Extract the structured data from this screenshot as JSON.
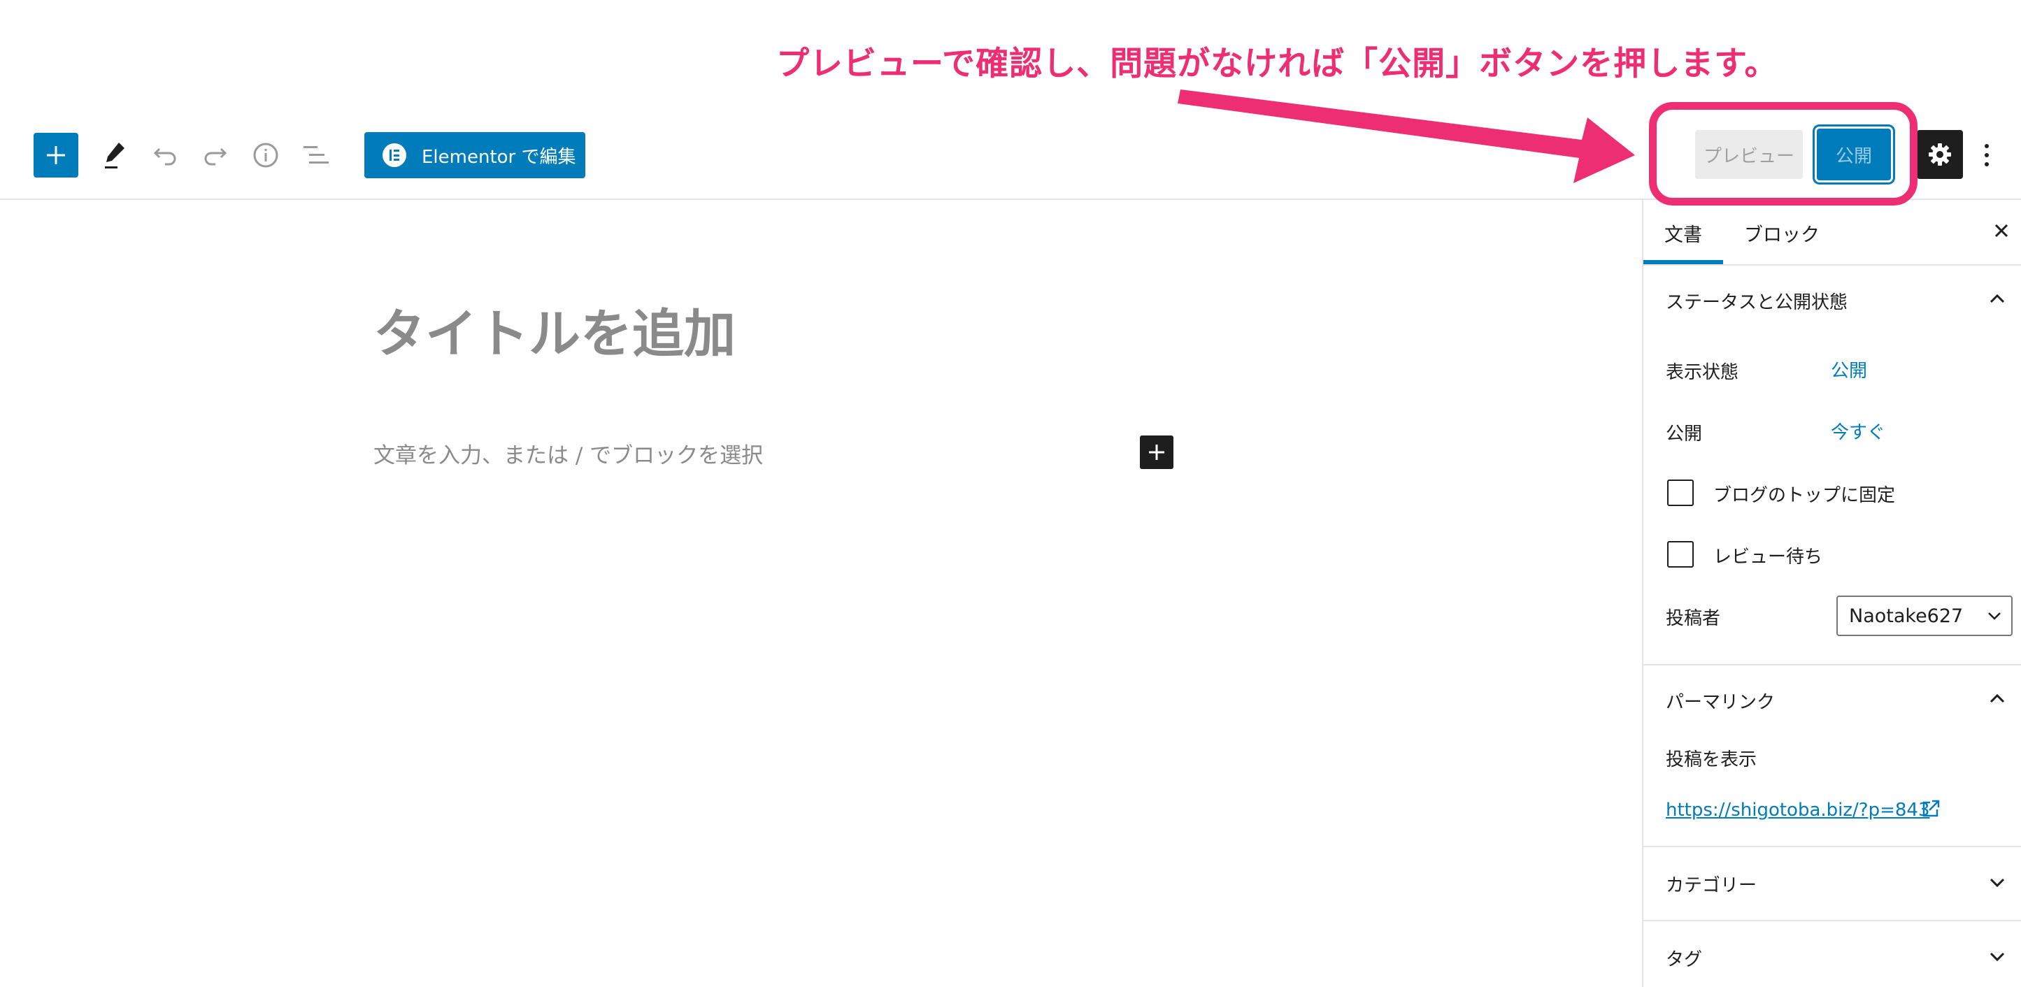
{
  "annotation": {
    "text": "プレビューで確認し、問題がなければ「公開」ボタンを押します。",
    "color": "#ee2e73"
  },
  "toolbar": {
    "elementor_label": "Elementor で編集",
    "preview_label": "プレビュー",
    "publish_label": "公開",
    "icons": [
      "plus-icon",
      "pencil-icon",
      "undo-icon",
      "redo-icon",
      "info-icon",
      "list-view-icon",
      "elementor-logo-icon",
      "gear-icon",
      "more-vertical-icon"
    ]
  },
  "editor": {
    "title_placeholder": "タイトルを追加",
    "paragraph_placeholder": "文章を入力、または / でブロックを選択"
  },
  "sidebar": {
    "tabs": [
      {
        "label": "文書",
        "active": true
      },
      {
        "label": "ブロック",
        "active": false
      }
    ],
    "status_panel": {
      "title": "ステータスと公開状態",
      "visibility_label": "表示状態",
      "visibility_value": "公開",
      "publish_label": "公開",
      "publish_value": "今すぐ",
      "sticky_label": "ブログのトップに固定",
      "sticky_checked": false,
      "pending_label": "レビュー待ち",
      "pending_checked": false,
      "author_label": "投稿者",
      "author_value": "Naotake627"
    },
    "permalink_panel": {
      "title": "パーマリンク",
      "view_label": "投稿を表示",
      "url": "https://shigotoba.biz/?p=843"
    },
    "category_panel": {
      "title": "カテゴリー"
    },
    "tag_panel": {
      "title": "タグ"
    }
  },
  "colors": {
    "accent": "#007cba",
    "dark": "#1e1e1e",
    "placeholder": "#8a8a8a",
    "annotation": "#ee2e73"
  }
}
